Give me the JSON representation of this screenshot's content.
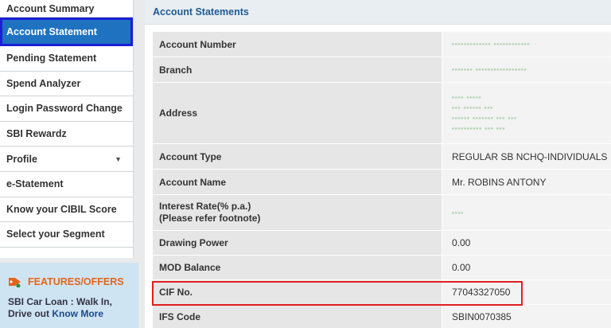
{
  "sidebar": {
    "items": [
      {
        "label": "Account Summary"
      },
      {
        "label": "Account Statement"
      },
      {
        "label": "Pending Statement"
      },
      {
        "label": "Spend Analyzer"
      },
      {
        "label": "Login Password Change"
      },
      {
        "label": "SBI Rewardz"
      },
      {
        "label": "Profile"
      },
      {
        "label": "e-Statement"
      },
      {
        "label": "Know your CIBIL Score"
      },
      {
        "label": "Select your Segment"
      }
    ]
  },
  "features": {
    "title": "FEATURES/OFFERS",
    "text_line1": "SBI Car Loan : Walk In,",
    "text_line2_prefix": "Drive out ",
    "link": "Know More"
  },
  "main": {
    "title": "Account Statements",
    "rows": [
      {
        "label": "Account Number",
        "value": "•••••••••••••  ••••••••••••"
      },
      {
        "label": "Branch",
        "value": "•••••••  •••••••••••••••••"
      },
      {
        "label": "Address",
        "value": "•••• •••••\n•••  •••••• •••\n•••••• •••••••  •••  •••\n••••••••••  ••• •••"
      },
      {
        "label": "Account Type",
        "value": "REGULAR SB NCHQ-INDIVIDUALS"
      },
      {
        "label": "Account Name",
        "value": "Mr. ROBINS ANTONY"
      },
      {
        "label": "Interest Rate(% p.a.)",
        "label2": "(Please refer footnote)",
        "value": "••••"
      },
      {
        "label": "Drawing Power",
        "value": "0.00"
      },
      {
        "label": "MOD Balance",
        "value": "0.00"
      },
      {
        "label": "CIF No.",
        "value": "77043327050"
      },
      {
        "label": "IFS Code",
        "value": "SBIN0070385"
      }
    ]
  },
  "colors": {
    "active_bg": "#1f72c0",
    "active_border": "#1b1fd6",
    "highlight": "#e01f1f",
    "features_title": "#e3651b"
  }
}
